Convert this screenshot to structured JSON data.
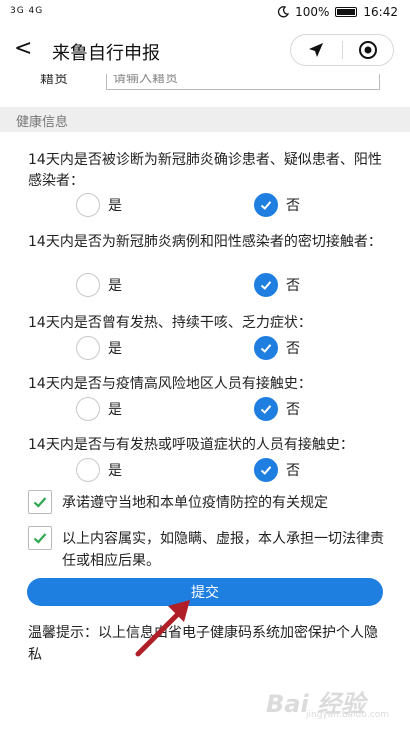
{
  "status": {
    "network": "3G 4G",
    "battery": "100%",
    "time": "16:42"
  },
  "header": {
    "back": "<",
    "title": "来鲁自行申报"
  },
  "cut_row": {
    "label": "籍贯",
    "input_value": "请输入籍贯"
  },
  "section": {
    "title": "健康信息"
  },
  "questions": [
    {
      "text": "14天内是否被诊断为新冠肺炎确诊患者、疑似患者、阳性感染者：",
      "yes": "是",
      "no": "否",
      "selected": "no"
    },
    {
      "text": "14天内是否为新冠肺炎病例和阳性感染者的密切接触者：",
      "yes": "是",
      "no": "否",
      "selected": "no"
    },
    {
      "text": "14天内是否曾有发热、持续干咳、乏力症状：",
      "yes": "是",
      "no": "否",
      "selected": "no"
    },
    {
      "text": "14天内是否与疫情高风险地区人员有接触史：",
      "yes": "是",
      "no": "否",
      "selected": "no"
    },
    {
      "text": "14天内是否与有发热或呼吸道症状的人员有接触史：",
      "yes": "是",
      "no": "否",
      "selected": "no"
    }
  ],
  "agreements": [
    {
      "text": "承诺遵守当地和本单位疫情防控的有关规定",
      "checked": true
    },
    {
      "text": "以上内容属实，如隐瞒、虚报，本人承担一切法律责任或相应后果。",
      "checked": true
    }
  ],
  "submit": {
    "label": "提交"
  },
  "tip": {
    "text": "温馨提示：以上信息由省电子健康码系统加密保护个人隐私"
  },
  "watermark": {
    "text": "Bai 经验",
    "sub": "jingyan.baidu.com"
  },
  "colors": {
    "accent": "#1e7fe0",
    "arrow": "#b01e28"
  }
}
